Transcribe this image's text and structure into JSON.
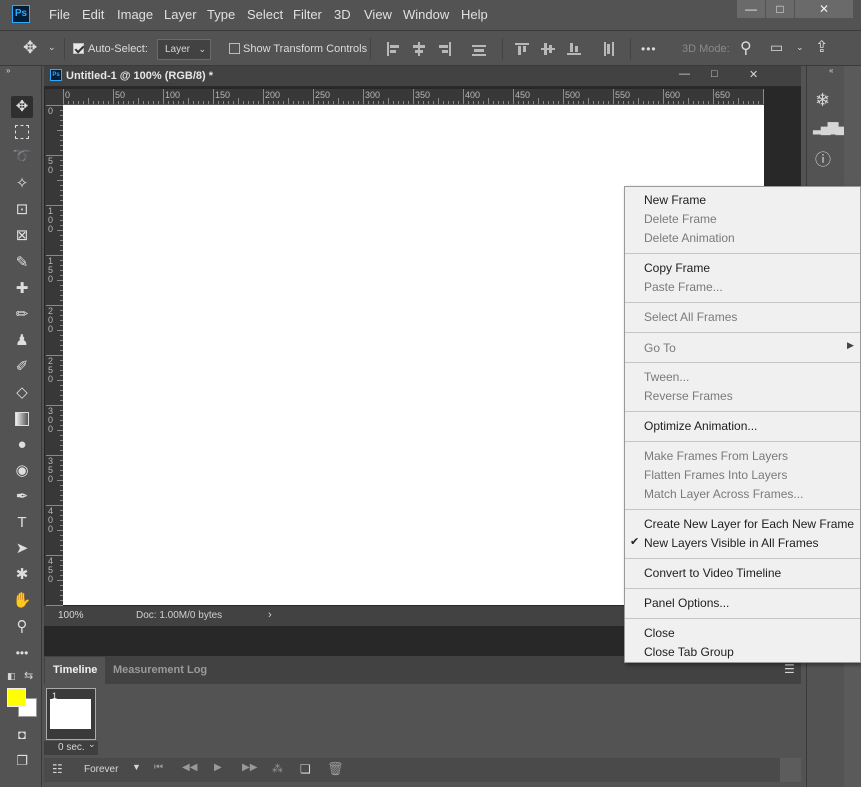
{
  "app": {
    "logo": "Ps"
  },
  "menubar": [
    "File",
    "Edit",
    "Image",
    "Layer",
    "Type",
    "Select",
    "Filter",
    "3D",
    "View",
    "Window",
    "Help"
  ],
  "window_controls": {
    "minimize": "—",
    "restore": "□",
    "close": "✕"
  },
  "options": {
    "auto_select_label": "Auto-Select:",
    "auto_select_target": "Layer",
    "show_transform_label": "Show Transform Controls",
    "more": "•••",
    "mode_3d": "3D Mode:"
  },
  "document": {
    "title": "Untitled-1 @ 100% (RGB/8) *",
    "zoom": "100%",
    "doc_info": "Doc: 1.00M/0 bytes",
    "ruler_h": [
      "0",
      "50",
      "100",
      "150",
      "200",
      "250",
      "300",
      "350",
      "400",
      "450",
      "500",
      "550",
      "600",
      "650"
    ],
    "ruler_v": [
      [
        "0"
      ],
      [
        "5",
        "0"
      ],
      [
        "1",
        "0",
        "0"
      ],
      [
        "1",
        "5",
        "0"
      ],
      [
        "2",
        "0",
        "0"
      ],
      [
        "2",
        "5",
        "0"
      ],
      [
        "3",
        "0",
        "0"
      ],
      [
        "3",
        "5",
        "0"
      ],
      [
        "4",
        "0",
        "0"
      ],
      [
        "4",
        "5",
        "0"
      ]
    ]
  },
  "timeline": {
    "tabs": [
      "Timeline",
      "Measurement Log"
    ],
    "frame_number": "1",
    "frame_delay": "0 sec.",
    "loop": "Forever"
  },
  "context_menu": [
    {
      "label": "New Frame",
      "enabled": true
    },
    {
      "label": "Delete Frame",
      "enabled": false
    },
    {
      "label": "Delete Animation",
      "enabled": false
    },
    {
      "label": "Copy Frame",
      "enabled": true
    },
    {
      "label": "Paste Frame...",
      "enabled": false
    },
    {
      "label": "Select All Frames",
      "enabled": false
    },
    {
      "label": "Go To",
      "enabled": false,
      "submenu": true
    },
    {
      "label": "Tween...",
      "enabled": false
    },
    {
      "label": "Reverse Frames",
      "enabled": false
    },
    {
      "label": "Optimize Animation...",
      "enabled": true
    },
    {
      "label": "Make Frames From Layers",
      "enabled": false
    },
    {
      "label": "Flatten Frames Into Layers",
      "enabled": false
    },
    {
      "label": "Match Layer Across Frames...",
      "enabled": false
    },
    {
      "label": "Create New Layer for Each New Frame",
      "enabled": true
    },
    {
      "label": "New Layers Visible in All Frames",
      "enabled": true,
      "checked": true
    },
    {
      "label": "Convert to Video Timeline",
      "enabled": true
    },
    {
      "label": "Panel Options...",
      "enabled": true
    },
    {
      "label": "Close",
      "enabled": true
    },
    {
      "label": "Close Tab Group",
      "enabled": true
    }
  ],
  "colors": {
    "foreground": "#ffff00",
    "background": "#ffffff",
    "ui_bg": "#535353",
    "ps_blue": "#31a8ff"
  }
}
